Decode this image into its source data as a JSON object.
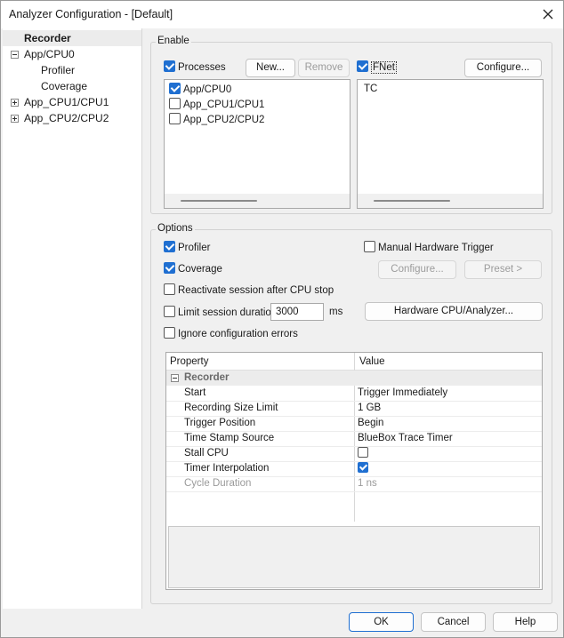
{
  "window": {
    "title": "Analyzer Configuration - [Default]"
  },
  "tree": {
    "items": [
      {
        "label": "Recorder"
      },
      {
        "label": "App/CPU0"
      },
      {
        "label": "Profiler"
      },
      {
        "label": "Coverage"
      },
      {
        "label": "App_CPU1/CPU1"
      },
      {
        "label": "App_CPU2/CPU2"
      }
    ]
  },
  "enable": {
    "label": "Enable",
    "processes_label": "Processes",
    "new_button": "New...",
    "remove_button": "Remove",
    "process_list": [
      "App/CPU0",
      "App_CPU1/CPU1",
      "App_CPU2/CPU2"
    ],
    "fnet_label": "FNet",
    "configure_button": "Configure...",
    "fnet_list": [
      "TC"
    ]
  },
  "options": {
    "label": "Options",
    "profiler": "Profiler",
    "coverage": "Coverage",
    "reactivate": "Reactivate session after CPU stop",
    "limit_duration": "Limit session duration",
    "duration_value": "3000",
    "duration_unit": "ms",
    "ignore_errors": "Ignore configuration errors",
    "manual_trigger": "Manual Hardware Trigger",
    "configure_button": "Configure...",
    "preset_button": "Preset >",
    "hardware_button": "Hardware CPU/Analyzer..."
  },
  "grid": {
    "col_property": "Property",
    "col_value": "Value",
    "category": "Recorder",
    "rows": [
      {
        "property": "Start",
        "value": "Trigger Immediately"
      },
      {
        "property": "Recording Size Limit",
        "value": "1 GB"
      },
      {
        "property": "Trigger Position",
        "value": "Begin"
      },
      {
        "property": "Time Stamp Source",
        "value": "BlueBox Trace Timer"
      },
      {
        "property": "Stall CPU",
        "value": ""
      },
      {
        "property": "Timer Interpolation",
        "value": ""
      },
      {
        "property": "Cycle Duration",
        "value": "1 ns"
      }
    ]
  },
  "footer": {
    "ok": "OK",
    "cancel": "Cancel",
    "help": "Help"
  }
}
